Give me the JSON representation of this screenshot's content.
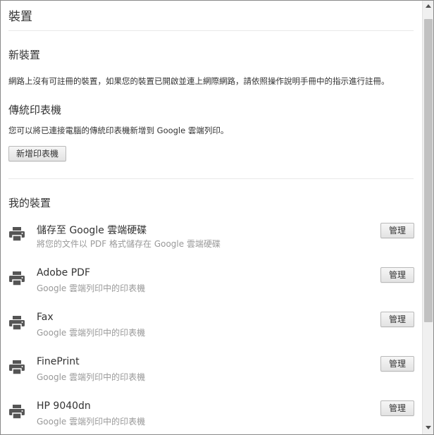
{
  "page": {
    "title": "裝置"
  },
  "new_devices": {
    "heading": "新裝置",
    "text": "網路上沒有可註冊的裝置，如果您的裝置已開啟並連上網際網路，請依照操作說明手冊中的指示進行註冊。"
  },
  "classic": {
    "heading": "傳統印表機",
    "text": "您可以將已連接電腦的傳統印表機新增到 Google 雲端列印。",
    "add_button": "新增印表機"
  },
  "my_devices": {
    "heading": "我的裝置",
    "items": [
      {
        "name": "儲存至 Google 雲端硬碟",
        "description": "將您的文件以 PDF 格式儲存在 Google 雲端硬碟",
        "icon": "printer-icon",
        "button": "管理"
      },
      {
        "name": "Adobe PDF",
        "description": "Google 雲端列印中的印表機",
        "icon": "printer-icon",
        "button": "管理"
      },
      {
        "name": "Fax",
        "description": "Google 雲端列印中的印表機",
        "icon": "printer-icon",
        "button": "管理"
      },
      {
        "name": "FinePrint",
        "description": "Google 雲端列印中的印表機",
        "icon": "printer-icon",
        "button": "管理"
      },
      {
        "name": "HP 9040dn",
        "description": "Google 雲端列印中的印表機",
        "icon": "printer-icon",
        "button": "管理"
      }
    ]
  },
  "scrollbar": {
    "up_icon": "scroll-up-arrow-icon",
    "down_icon": "scroll-down-arrow-icon"
  }
}
